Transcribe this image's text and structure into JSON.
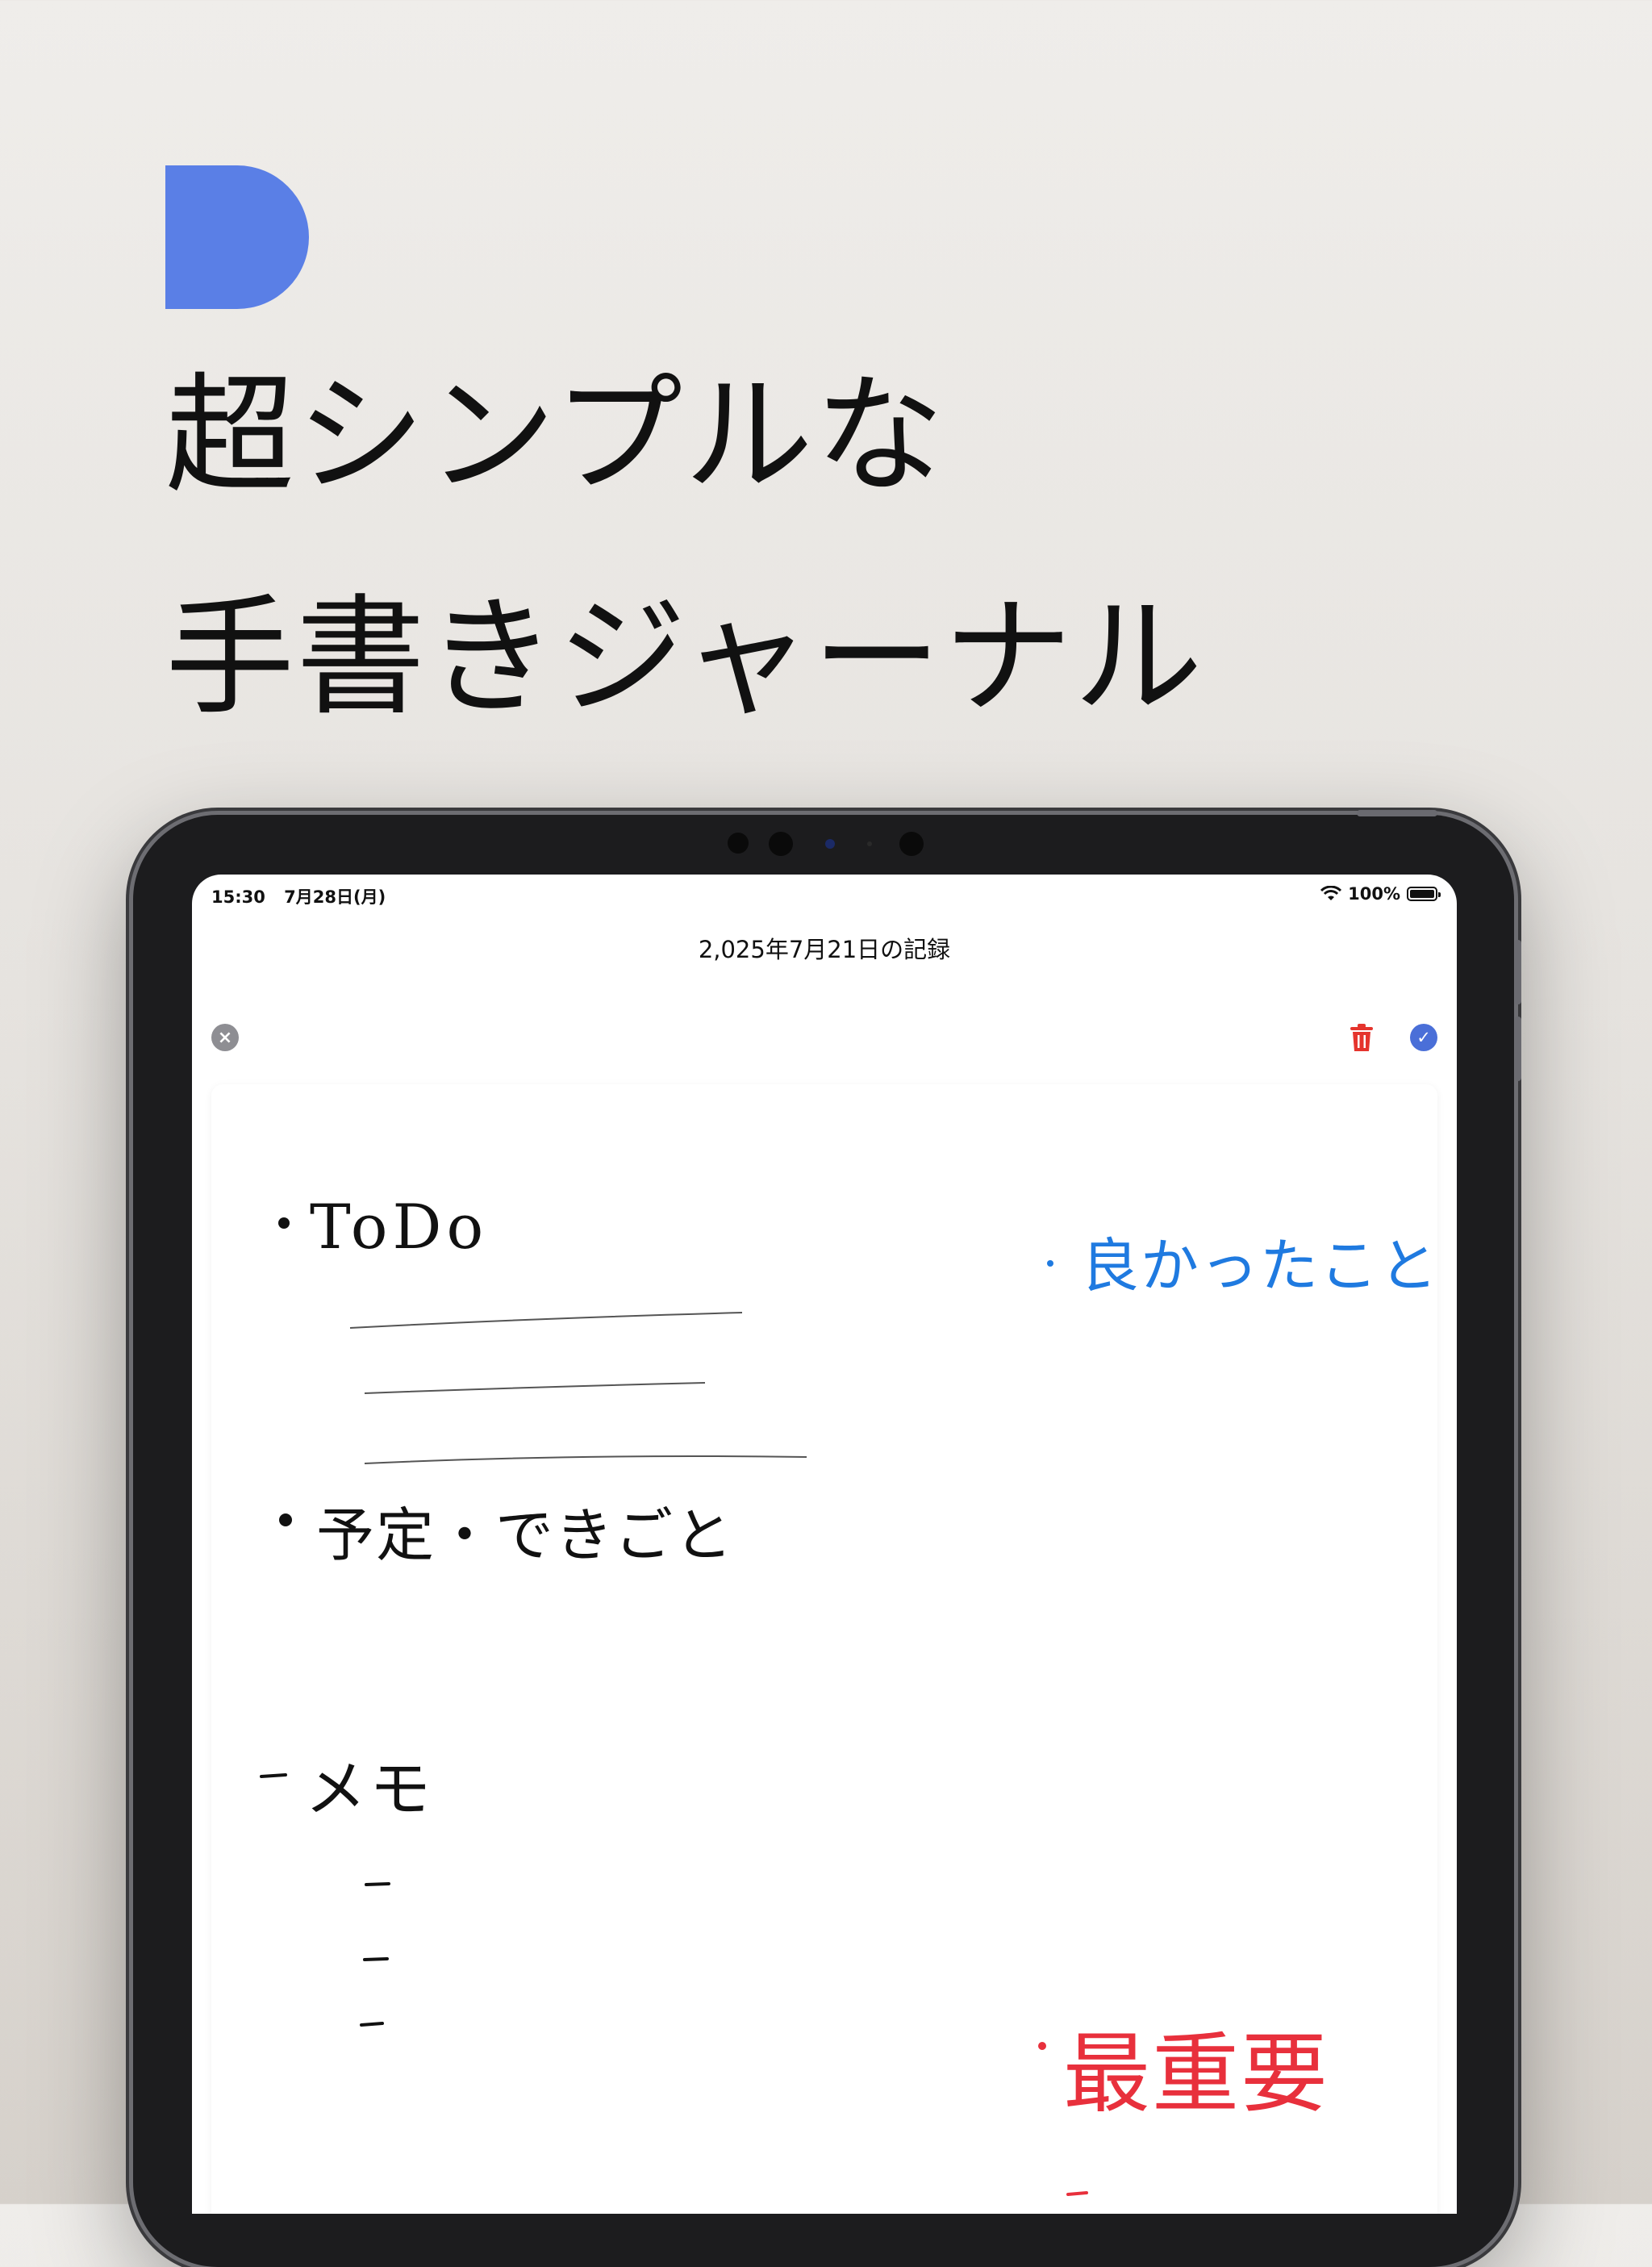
{
  "headline": {
    "line1": "超シンプルな",
    "line2": "手書きジャーナル"
  },
  "status_bar": {
    "time": "15:30",
    "date": "7月28日(月)",
    "battery": "100%"
  },
  "nav": {
    "title": "2,025年7月21日の記録",
    "close_icon": "×",
    "check_icon": "✓"
  },
  "note": {
    "todo": "ToDo",
    "schedule": "予定・できごと",
    "memo": "メモ",
    "good_things": "良かったこと",
    "most_important": "最重要"
  },
  "colors": {
    "accent": "#5a7fe6",
    "ink_black": "#111111",
    "ink_blue": "#1f7ae0",
    "ink_red": "#e8303c",
    "trash": "#e5342d",
    "confirm": "#4a6fd8"
  }
}
